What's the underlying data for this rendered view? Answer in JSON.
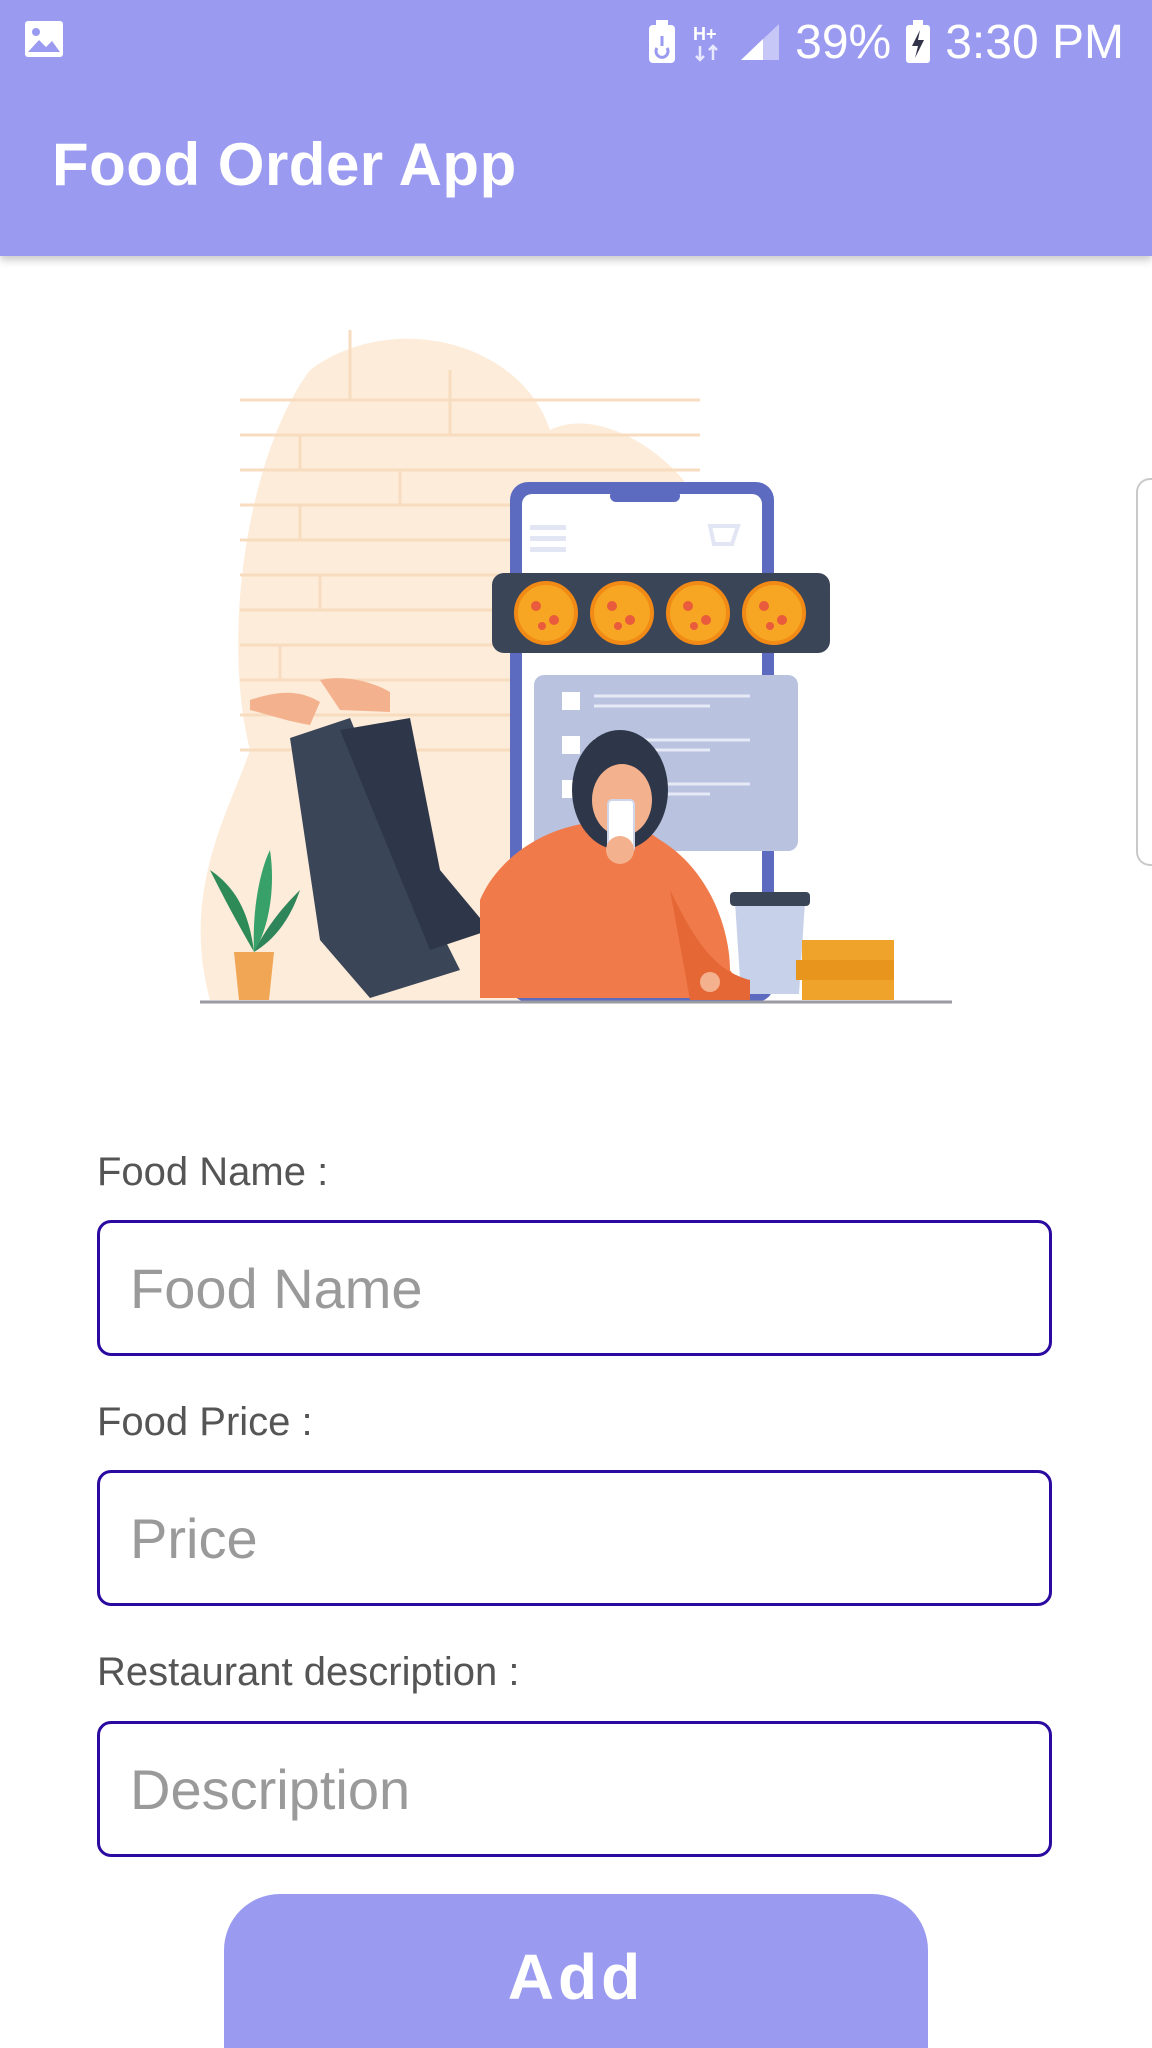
{
  "status_bar": {
    "battery_percent": "39%",
    "time": "3:30 PM",
    "icons": [
      "image-icon",
      "battery-saver-icon",
      "hplus-network-icon",
      "signal-icon",
      "battery-charging-icon"
    ]
  },
  "app_bar": {
    "title": "Food Order App"
  },
  "form": {
    "food_name": {
      "label": "Food Name :",
      "placeholder": "Food Name"
    },
    "food_price": {
      "label": "Food Price :",
      "placeholder": "Price"
    },
    "description": {
      "label": "Restaurant description :",
      "placeholder": "Description"
    },
    "add_button": "Add"
  },
  "colors": {
    "accent": "#9a9af0",
    "field_border": "#2b0aa0",
    "label_text": "#555555",
    "placeholder_text": "#9a9a9a"
  }
}
